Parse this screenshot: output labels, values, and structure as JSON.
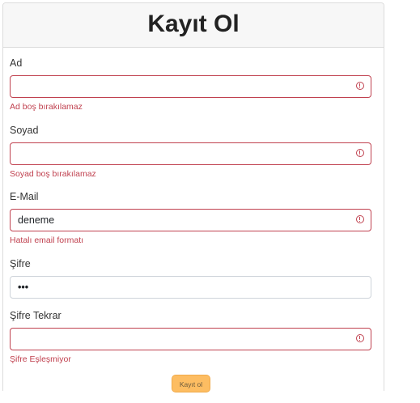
{
  "header": {
    "title": "Kayıt Ol"
  },
  "form": {
    "ad": {
      "label": "Ad",
      "value": "",
      "error": "Ad boş bırakılamaz"
    },
    "soyad": {
      "label": "Soyad",
      "value": "",
      "error": "Soyad boş bırakılamaz"
    },
    "email": {
      "label": "E-Mail",
      "value": "deneme",
      "error": "Hatalı email formatı"
    },
    "sifre": {
      "label": "Şifre",
      "value": "•••"
    },
    "sifre_tekrar": {
      "label": "Şifre Tekrar",
      "value": "",
      "error": "Şifre Eşleşmiyor"
    }
  },
  "submit_label": "Kayıt ol",
  "colors": {
    "error": "#c0414f",
    "button": "#fdbd62",
    "header_bg": "#f7f7f7"
  },
  "icons": {
    "invalid": "exclamation-circle-icon"
  }
}
